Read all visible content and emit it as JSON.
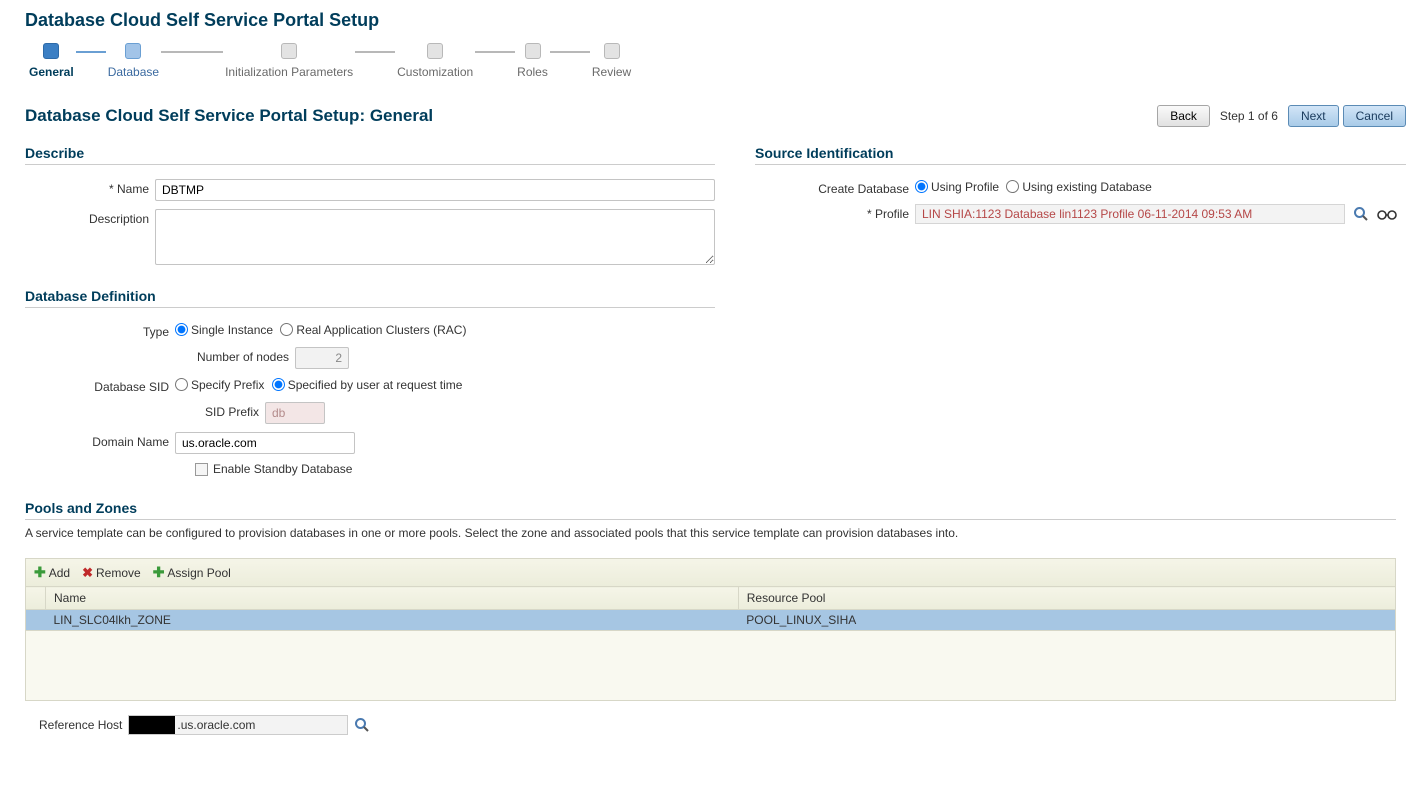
{
  "page_title": "Database Cloud Self Service Portal Setup",
  "wizard": {
    "steps": [
      {
        "label": "General",
        "state": "active"
      },
      {
        "label": "Database",
        "state": "next"
      },
      {
        "label": "Initialization Parameters",
        "state": "pending"
      },
      {
        "label": "Customization",
        "state": "pending"
      },
      {
        "label": "Roles",
        "state": "pending"
      },
      {
        "label": "Review",
        "state": "pending"
      }
    ]
  },
  "content_title": "Database Cloud Self Service Portal Setup: General",
  "nav": {
    "back": "Back",
    "step_text": "Step 1 of 6",
    "next": "Next",
    "cancel": "Cancel"
  },
  "describe": {
    "heading": "Describe",
    "name_label": "Name",
    "name_value": "DBTMP",
    "description_label": "Description",
    "description_value": ""
  },
  "source": {
    "heading": "Source Identification",
    "create_label": "Create Database",
    "opt_profile": "Using Profile",
    "opt_existing": "Using existing Database",
    "profile_label": "Profile",
    "profile_value": "LIN SHIA:1123 Database lin1123 Profile 06-11-2014 09:53 AM"
  },
  "definition": {
    "heading": "Database Definition",
    "type_label": "Type",
    "opt_single": "Single Instance",
    "opt_rac": "Real Application Clusters (RAC)",
    "nodes_label": "Number of nodes",
    "nodes_value": "2",
    "sid_label": "Database SID",
    "opt_prefix": "Specify Prefix",
    "opt_user": "Specified by user at request time",
    "prefix_label": "SID Prefix",
    "prefix_value": "db",
    "domain_label": "Domain Name",
    "domain_value": "us.oracle.com",
    "standby_label": "Enable Standby Database"
  },
  "pools": {
    "heading": "Pools and Zones",
    "description": "A service template can be configured to provision databases in one or more pools. Select the zone and associated pools that this service template can provision databases into.",
    "add": "Add",
    "remove": "Remove",
    "assign": "Assign Pool",
    "col_name": "Name",
    "col_pool": "Resource Pool",
    "rows": [
      {
        "name": "LIN_SLC04lkh_ZONE",
        "pool": "POOL_LINUX_SIHA"
      }
    ]
  },
  "ref_host": {
    "label": "Reference Host",
    "suffix": ".us.oracle.com"
  }
}
